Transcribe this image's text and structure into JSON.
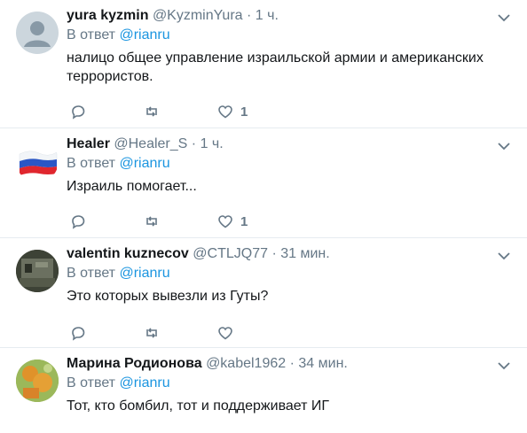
{
  "tweets": [
    {
      "name": "yura kyzmin",
      "handle": "@KyzminYura",
      "time": "1 ч.",
      "reply_prefix": "В ответ",
      "reply_to": "@rianru",
      "text": "налицо общее управление израильской армии и американских террористов.",
      "like_count": "1",
      "avatar": "default-avatar"
    },
    {
      "name": "Healer",
      "handle": "@Healer_S",
      "time": "1 ч.",
      "reply_prefix": "В ответ",
      "reply_to": "@rianru",
      "text": "Израиль помогает...",
      "like_count": "1",
      "avatar": "russian-flag"
    },
    {
      "name": "valentin kuznecov",
      "handle": "@CTLJQ77",
      "time": "31 мин.",
      "reply_prefix": "В ответ",
      "reply_to": "@rianru",
      "text": "Это которых вывезли из Гуты?",
      "like_count": "",
      "avatar": "photo"
    },
    {
      "name": "Марина Родионова",
      "handle": "@kabel1962",
      "time": "34 мин.",
      "reply_prefix": "В ответ",
      "reply_to": "@rianru",
      "text": "Тот, кто бомбил, тот и поддерживает ИГ",
      "like_count": "",
      "avatar": "photo"
    }
  ],
  "separator": "·",
  "colors": {
    "accent": "#1b95e0",
    "muted": "#657786",
    "text": "#14171a",
    "divider": "#e6ecf0"
  }
}
